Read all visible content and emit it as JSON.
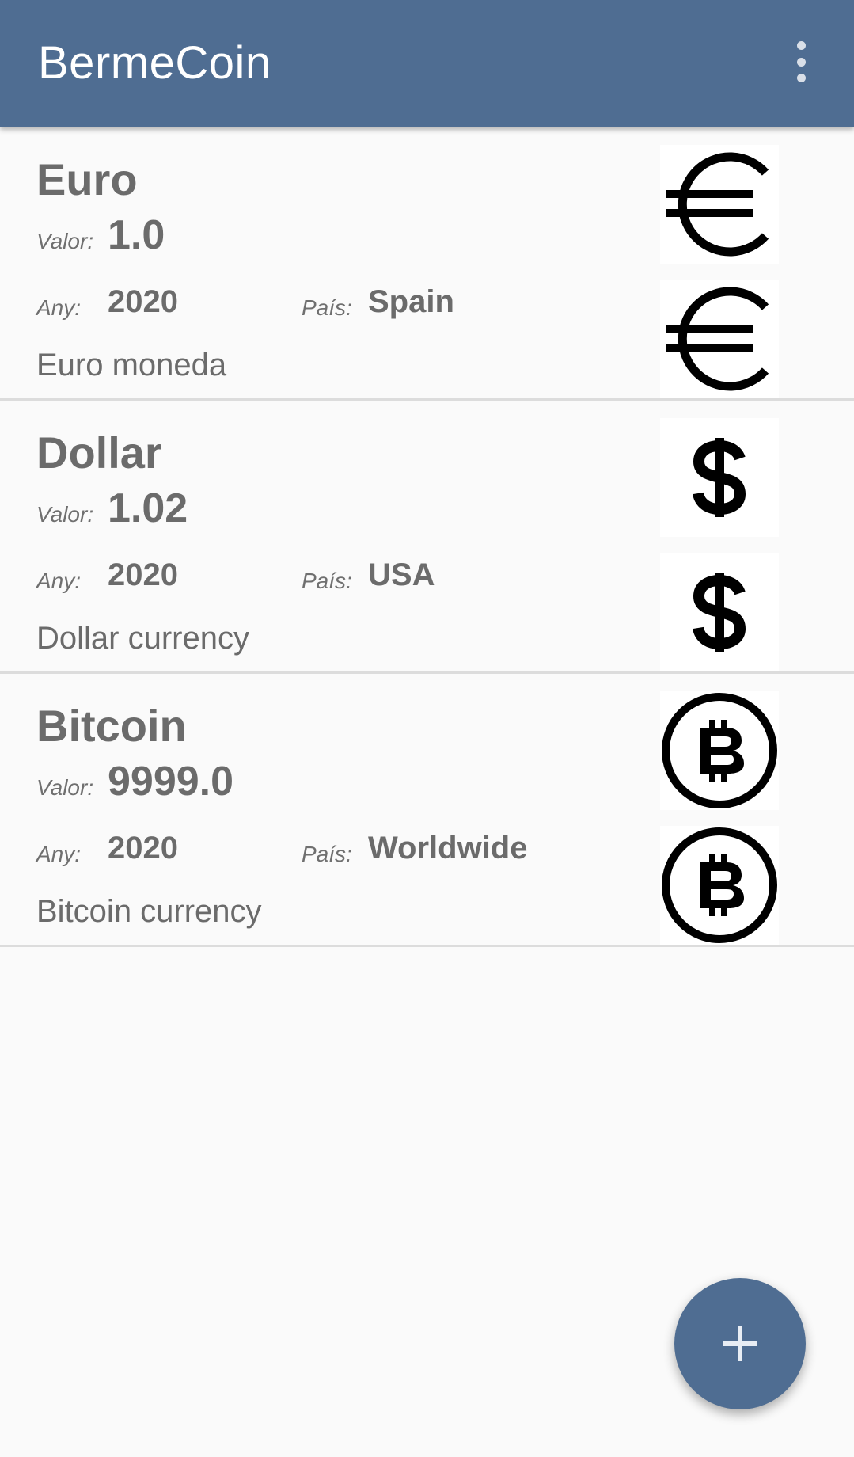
{
  "app_title": "BermeCoin",
  "colors": {
    "app_bar": "#4f6d92",
    "fab": "#4f6d92",
    "text": "#6b6b6b"
  },
  "labels": {
    "valor": "Valor:",
    "any": "Any:",
    "pais": "País:"
  },
  "coins": [
    {
      "name": "Euro",
      "valor": "1.0",
      "any": "2020",
      "pais": "Spain",
      "description": "Euro moneda",
      "icon": "euro-icon"
    },
    {
      "name": "Dollar",
      "valor": "1.02",
      "any": "2020",
      "pais": "USA",
      "description": "Dollar currency",
      "icon": "dollar-icon"
    },
    {
      "name": "Bitcoin",
      "valor": "9999.0",
      "any": "2020",
      "pais": "Worldwide",
      "description": "Bitcoin currency",
      "icon": "bitcoin-icon"
    }
  ],
  "fab_icon": "plus-icon",
  "menu_icon": "more-vert-icon"
}
